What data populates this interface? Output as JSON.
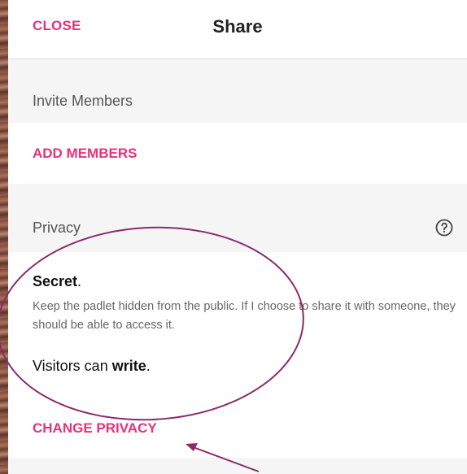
{
  "header": {
    "close_label": "CLOSE",
    "title": "Share"
  },
  "invite": {
    "heading": "Invite Members",
    "add_label": "ADD MEMBERS"
  },
  "privacy": {
    "heading": "Privacy",
    "level_name": "Secret",
    "level_suffix": ".",
    "description": "Keep the padlet hidden from the public. If I choose to share it with someone, they should be able to access it.",
    "visitors_prefix": "Visitors can ",
    "visitors_permission": "write",
    "visitors_suffix": ".",
    "change_label": "CHANGE PRIVACY",
    "help_icon": "question-circle-icon"
  },
  "colors": {
    "accent": "#e8317a",
    "annotation": "#8c2a6a",
    "section_bg": "#f5f5f5"
  }
}
